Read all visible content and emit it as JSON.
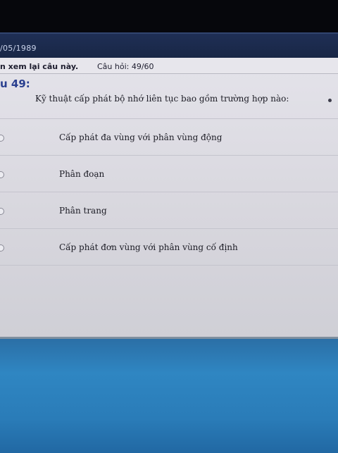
{
  "header": {
    "date": "/05/1989"
  },
  "info_bar": {
    "review_note": "n xem lại câu này.",
    "question_counter": "Câu hỏi: 49/60"
  },
  "question": {
    "number_label": "u 49:",
    "text": "Kỹ thuật cấp phát bộ nhớ liên tục bao gồm trường hợp nào:"
  },
  "options": [
    {
      "label": "Cấp phát đa vùng với phân vùng động"
    },
    {
      "label": "Phân đoạn"
    },
    {
      "label": "Phân trang"
    },
    {
      "label": "Cấp phát đơn vùng với phân vùng cố định"
    }
  ]
}
